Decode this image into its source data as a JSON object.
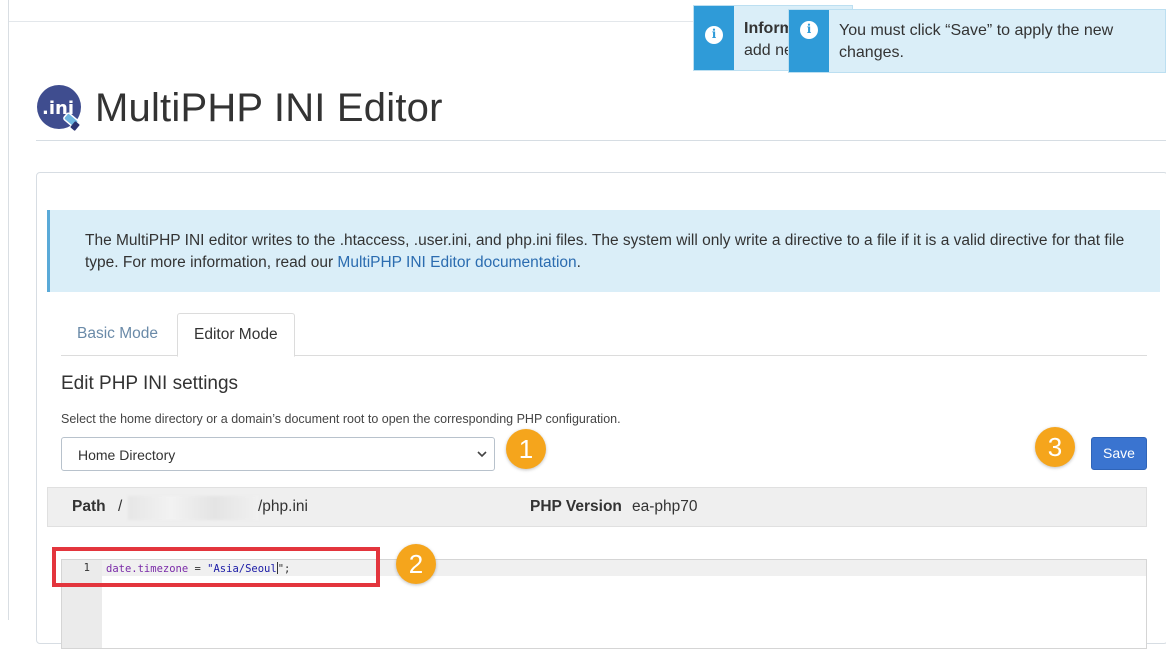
{
  "header": {
    "title": "MultiPHP INI Editor",
    "logo_text": ".ini"
  },
  "toasts": [
    {
      "title": "Inform",
      "body": "add new c"
    },
    {
      "message_line1": "You must click “Save” to apply the new",
      "message_line2": "changes."
    }
  ],
  "info": {
    "text_part1": "The MultiPHP INI editor writes to the .htaccess, .user.ini, and php.ini files. The system will only write a directive to a file if it is a valid directive for that file type. For more information, read our ",
    "link_text": "MultiPHP INI Editor documentation",
    "text_part2": "."
  },
  "tabs": [
    {
      "label": "Basic Mode",
      "active": false
    },
    {
      "label": "Editor Mode",
      "active": true
    }
  ],
  "editor": {
    "section_title": "Edit PHP INI settings",
    "help_text": "Select the home directory or a domain’s document root to open the corresponding PHP configuration.",
    "directory_select": {
      "selected": "Home Directory"
    },
    "save_label": "Save",
    "path_label": "Path",
    "path_prefix": "/",
    "path_value": "/php.ini",
    "php_version_label": "PHP Version",
    "php_version_value": "ea-php70",
    "code": {
      "line_number": "1",
      "key": "date.timezone",
      "operator": " = ",
      "value_before_cursor": "\"Asia/Seoul",
      "value_after_cursor": "\";"
    }
  },
  "callouts": [
    "1",
    "2",
    "3"
  ],
  "colors": {
    "accent": "#3a74d0",
    "callout": "#f5a51c",
    "highlight": "#e3353d",
    "info_bg": "#daeef8",
    "toast_icon": "#2f9bd8"
  },
  "icons": [
    "ini-logo-icon",
    "chevron-down-icon",
    "info-icon"
  ]
}
